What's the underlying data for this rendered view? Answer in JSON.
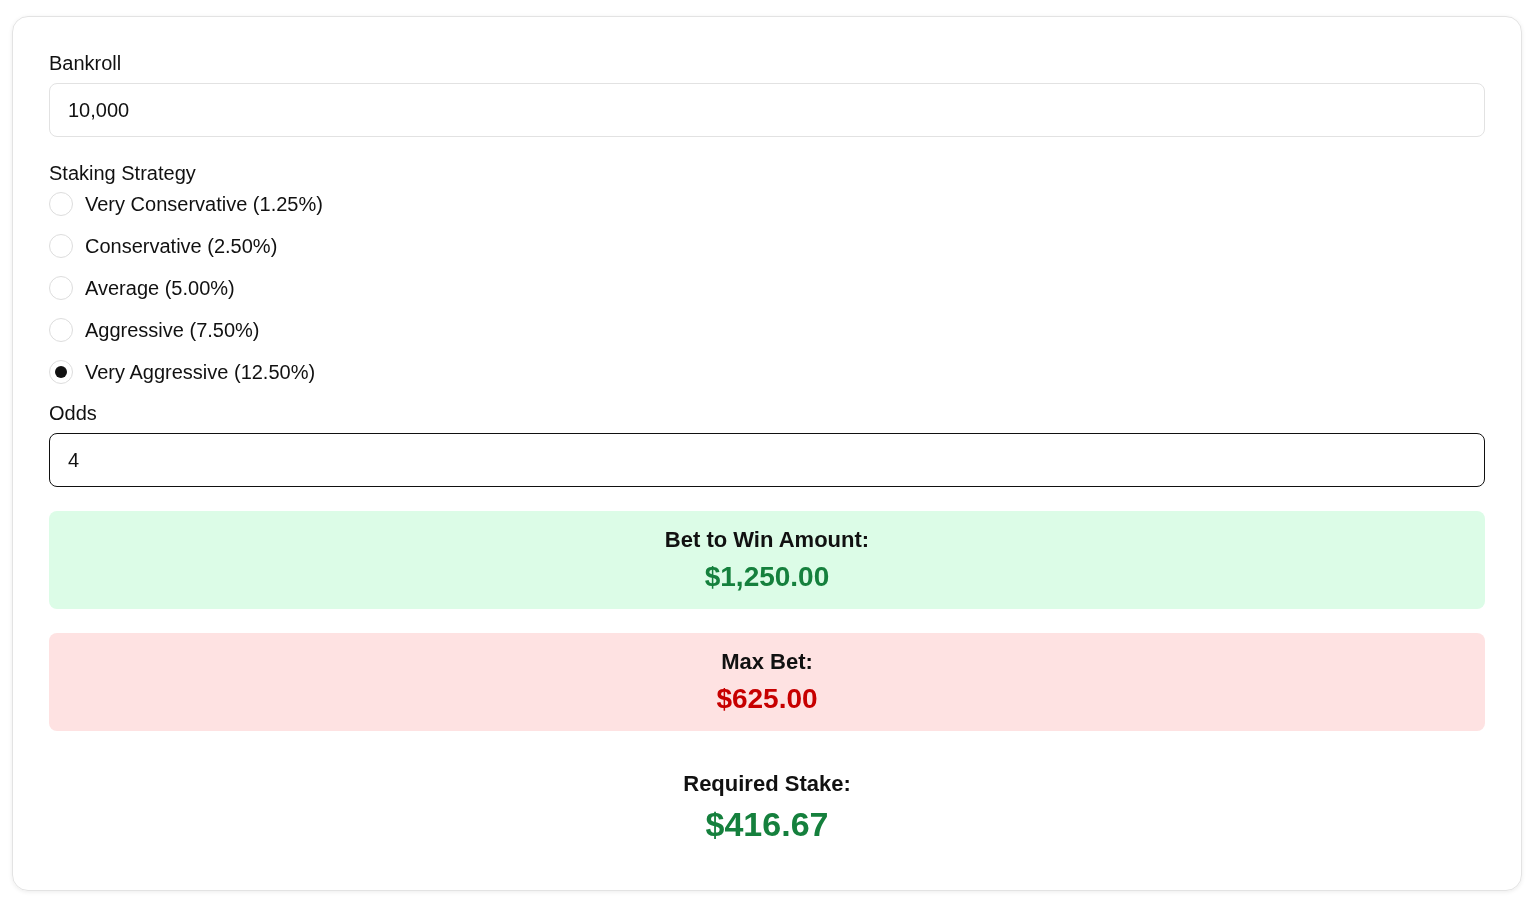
{
  "bankroll": {
    "label": "Bankroll",
    "value": "10,000",
    "focused": false
  },
  "strategy": {
    "label": "Staking Strategy",
    "options": [
      {
        "label": "Very Conservative (1.25%)",
        "selected": false
      },
      {
        "label": "Conservative (2.50%)",
        "selected": false
      },
      {
        "label": "Average (5.00%)",
        "selected": false
      },
      {
        "label": "Aggressive (7.50%)",
        "selected": false
      },
      {
        "label": "Very Aggressive (12.50%)",
        "selected": true
      }
    ]
  },
  "odds": {
    "label": "Odds",
    "value": "4",
    "focused": true
  },
  "results": [
    {
      "kind": "success",
      "title": "Bet to Win Amount:",
      "value": "$1,250.00"
    },
    {
      "kind": "danger",
      "title": "Max Bet:",
      "value": "$625.00"
    },
    {
      "kind": "plain",
      "title": "Required Stake:",
      "value": "$416.67"
    }
  ]
}
